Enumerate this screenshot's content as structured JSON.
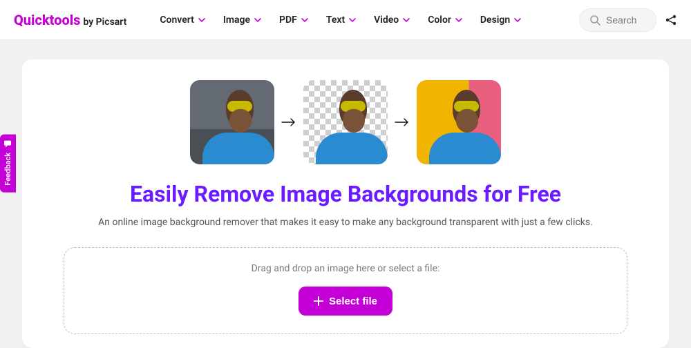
{
  "brand": {
    "name": "Quicktools",
    "byline": "by Picsart"
  },
  "nav": {
    "items": [
      {
        "label": "Convert"
      },
      {
        "label": "Image"
      },
      {
        "label": "PDF"
      },
      {
        "label": "Text"
      },
      {
        "label": "Video"
      },
      {
        "label": "Color"
      },
      {
        "label": "Design"
      }
    ]
  },
  "search": {
    "placeholder": "Search"
  },
  "feedback": {
    "label": "Feedback"
  },
  "hero": {
    "title": "Easily Remove Image Backgrounds for Free",
    "subtitle": "An online image background remover that makes it easy to make any background transparent with just a few clicks."
  },
  "dropzone": {
    "prompt": "Drag and drop an image here or select a file:",
    "button_label": "Select file"
  },
  "colors": {
    "accent_primary": "#c400d6",
    "accent_secondary": "#6a1bff"
  }
}
